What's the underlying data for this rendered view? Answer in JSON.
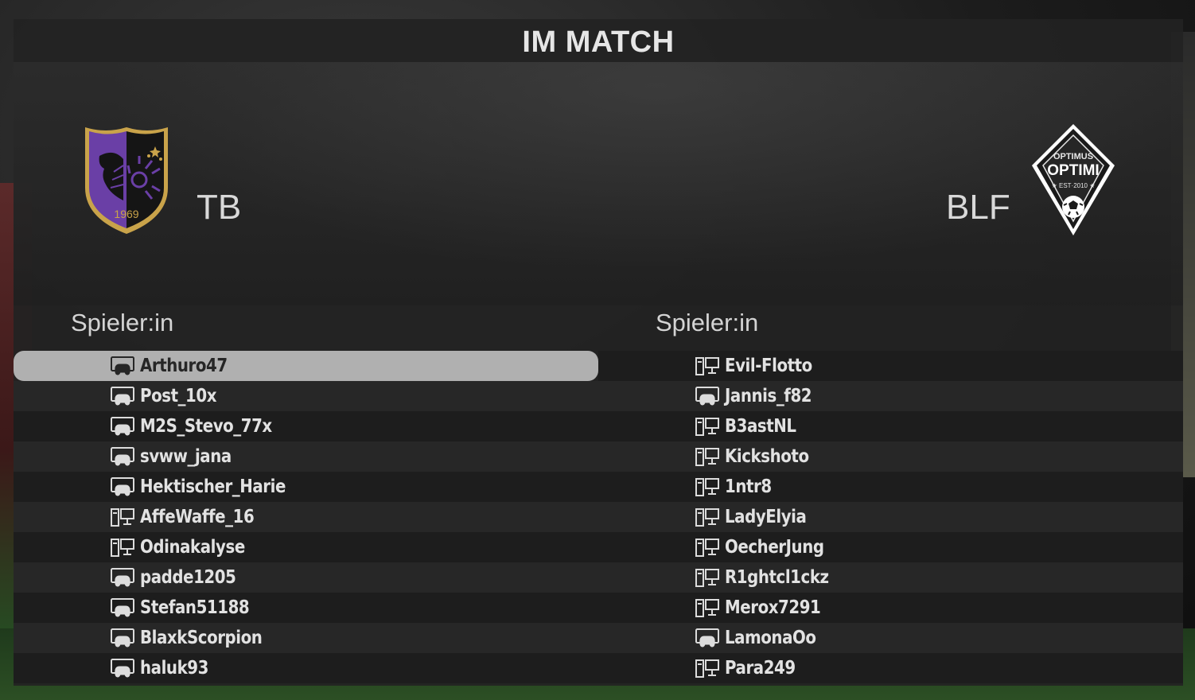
{
  "title": "IM MATCH",
  "home": {
    "abbr": "TB",
    "crest_text": "1969",
    "crest_colors": [
      "#6a3fa6",
      "#111111",
      "#c9a34a"
    ],
    "column_header": "Spieler:in",
    "players": [
      {
        "name": "Arthuro47",
        "platform": "console-icon",
        "selected": true
      },
      {
        "name": "Post_10x",
        "platform": "console-icon",
        "selected": false
      },
      {
        "name": "M2S_Stevo_77x",
        "platform": "console-icon",
        "selected": false
      },
      {
        "name": "svww_jana",
        "platform": "console-icon",
        "selected": false
      },
      {
        "name": "Hektischer_Harie",
        "platform": "console-icon",
        "selected": false
      },
      {
        "name": "AffeWaffe_16",
        "platform": "pc-icon",
        "selected": false
      },
      {
        "name": "Odinakalyse",
        "platform": "pc-icon",
        "selected": false
      },
      {
        "name": "padde1205",
        "platform": "console-icon",
        "selected": false
      },
      {
        "name": "Stefan51188",
        "platform": "console-icon",
        "selected": false
      },
      {
        "name": "BlaxkScorpion",
        "platform": "console-icon",
        "selected": false
      },
      {
        "name": "haluk93",
        "platform": "console-icon",
        "selected": false
      }
    ]
  },
  "away": {
    "abbr": "BLF",
    "crest_text_top": "OPTIMUS",
    "crest_text_main": "OPTIMI",
    "crest_text_est": "★ EST·2010 ★",
    "crest_colors": [
      "#1a1a1a",
      "#ffffff"
    ],
    "column_header": "Spieler:in",
    "players": [
      {
        "name": "Evil-Flotto",
        "platform": "pc-icon",
        "selected": false
      },
      {
        "name": "Jannis_f82",
        "platform": "console-icon",
        "selected": false
      },
      {
        "name": "B3astNL",
        "platform": "pc-icon",
        "selected": false
      },
      {
        "name": "Kickshoto",
        "platform": "pc-icon",
        "selected": false
      },
      {
        "name": "1ntr8",
        "platform": "pc-icon",
        "selected": false
      },
      {
        "name": "LadyElyia",
        "platform": "pc-icon",
        "selected": false
      },
      {
        "name": "OecherJung",
        "platform": "pc-icon",
        "selected": false
      },
      {
        "name": "R1ghtcl1ckz",
        "platform": "pc-icon",
        "selected": false
      },
      {
        "name": "Merox7291",
        "platform": "pc-icon",
        "selected": false
      },
      {
        "name": "LamonaOo",
        "platform": "console-icon",
        "selected": false
      },
      {
        "name": "Para249",
        "platform": "pc-icon",
        "selected": false
      }
    ]
  }
}
